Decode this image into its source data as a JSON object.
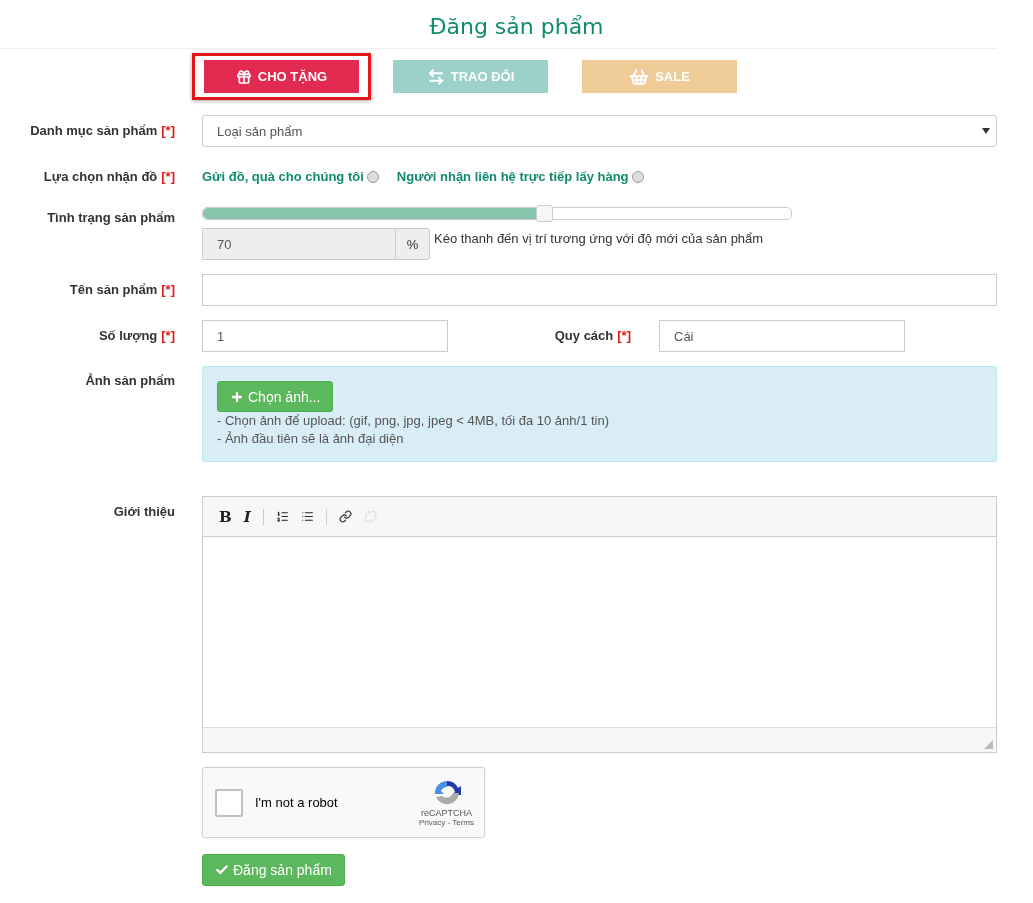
{
  "title": "Đăng sản phẩm",
  "types": [
    {
      "label": "CHO TẶNG",
      "kind": "gift",
      "color": "#e2294f",
      "selected": true
    },
    {
      "label": "TRAO ĐỔI",
      "kind": "exchange",
      "color": "#9bd1ca",
      "selected": false
    },
    {
      "label": "SALE",
      "kind": "basket",
      "color": "#efcb98",
      "selected": false
    }
  ],
  "category": {
    "label": "Danh mục sản phẩm",
    "required_mark": "[*]",
    "value": "Loại sản phẩm"
  },
  "receive": {
    "label": "Lựa chọn nhận đồ",
    "required_mark": "[*]",
    "options": [
      {
        "label": "Gửi đồ, quà cho chúng tôi",
        "selected": false
      },
      {
        "label": "Người nhận liên hệ trực tiếp lấy hàng",
        "selected": false
      }
    ]
  },
  "condition": {
    "label": "Tình trạng sản phẩm",
    "level": 0.58,
    "value": "70",
    "unit": "%",
    "hint": "Kéo thanh đến vị trí tương ứng với độ mới của sản phẩm"
  },
  "name": {
    "label": "Tên sản phẩm",
    "required_mark": "[*]"
  },
  "quantity": {
    "label": "Số lượng",
    "required_mark": "[*]",
    "value": "1"
  },
  "unit_spec": {
    "label": "Quy cách",
    "required_mark": "[*]",
    "value": "Cái"
  },
  "images": {
    "label": "Ảnh sản phẩm",
    "button": "Chọn ảnh...",
    "notes": [
      "- Chọn ảnh để upload: (gif, png, jpg, jpeg < 4MB, tối đa 10 ảnh/1 tin)",
      "- Ảnh đầu tiên sẽ là ảnh đại diện"
    ]
  },
  "intro": {
    "label": "Giới thiệu",
    "toolbar": [
      [
        {
          "kind": "bold",
          "label": "B",
          "disabled": false
        },
        {
          "kind": "italic",
          "label": "I",
          "disabled": false
        }
      ],
      [
        {
          "kind": "ordered-list",
          "disabled": false
        },
        {
          "kind": "bullet-list",
          "disabled": false
        }
      ],
      [
        {
          "kind": "link",
          "disabled": false
        },
        {
          "kind": "unlink",
          "disabled": true
        }
      ]
    ]
  },
  "captcha": {
    "checked": false,
    "label": "I'm not a robot",
    "brand": "reCAPTCHA",
    "footer": "Privacy - Terms"
  },
  "submit": "Đăng sản phẩm"
}
